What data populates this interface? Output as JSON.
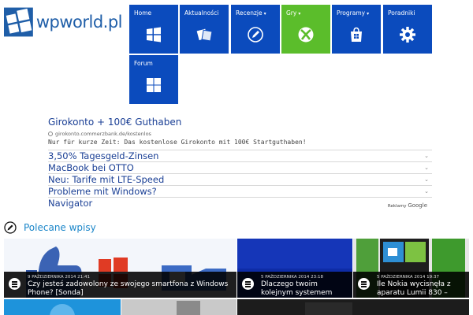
{
  "site": {
    "logo_text": "wpworld.pl"
  },
  "nav": [
    {
      "label": "Home",
      "icon": "windows-icon",
      "dropdown": false
    },
    {
      "label": "Aktualności",
      "icon": "cards-icon",
      "dropdown": false
    },
    {
      "label": "Recenzje",
      "icon": "pencil-icon",
      "dropdown": true
    },
    {
      "label": "Gry",
      "icon": "xbox-icon",
      "dropdown": true
    },
    {
      "label": "Programy",
      "icon": "store-icon",
      "dropdown": true
    },
    {
      "label": "Poradniki",
      "icon": "gear-icon",
      "dropdown": false
    },
    {
      "label": "Forum",
      "icon": "windows-grid-icon",
      "dropdown": false
    }
  ],
  "colors": {
    "tile": "#0b4bbd",
    "tile_active": "#5bbd2b",
    "link": "#1a3f95",
    "accent": "#1b86c9"
  },
  "ads": {
    "main": {
      "title": "Girokonto + 100€ Guthaben",
      "url": "girokonto.commerzbank.de/kostenlos",
      "description": "Nur für kurze Zeit: Das kostenlose Girokonto mit 100€ Startguthaben!"
    },
    "links": [
      "3,50% Tagesgeld-Zinsen",
      "MacBook bei OTTO",
      "Neu: Tarife mit LTE-Speed",
      "Probleme mit Windows?",
      "Navigator"
    ],
    "label_prefix": "Reklamy",
    "label_brand": "Google"
  },
  "featured": {
    "heading": "Polecane wpisy",
    "posts": [
      {
        "date": "9 PAŹDZIERNIKA 2014 21:41",
        "title": "Czy jesteś zadowolony ze swojego smartfona z Windows Phone? [Sonda]"
      },
      {
        "date": "5 PAŹDZIERNIKA 2014 23:18",
        "title": "Dlaczego twoim kolejnym systemem mobilnym"
      },
      {
        "date": "5 PAŹDZIERNIKA 2014 19:37",
        "title": "Ile Nokia wycisnęła z aparatu Lumii 830 –"
      }
    ]
  }
}
